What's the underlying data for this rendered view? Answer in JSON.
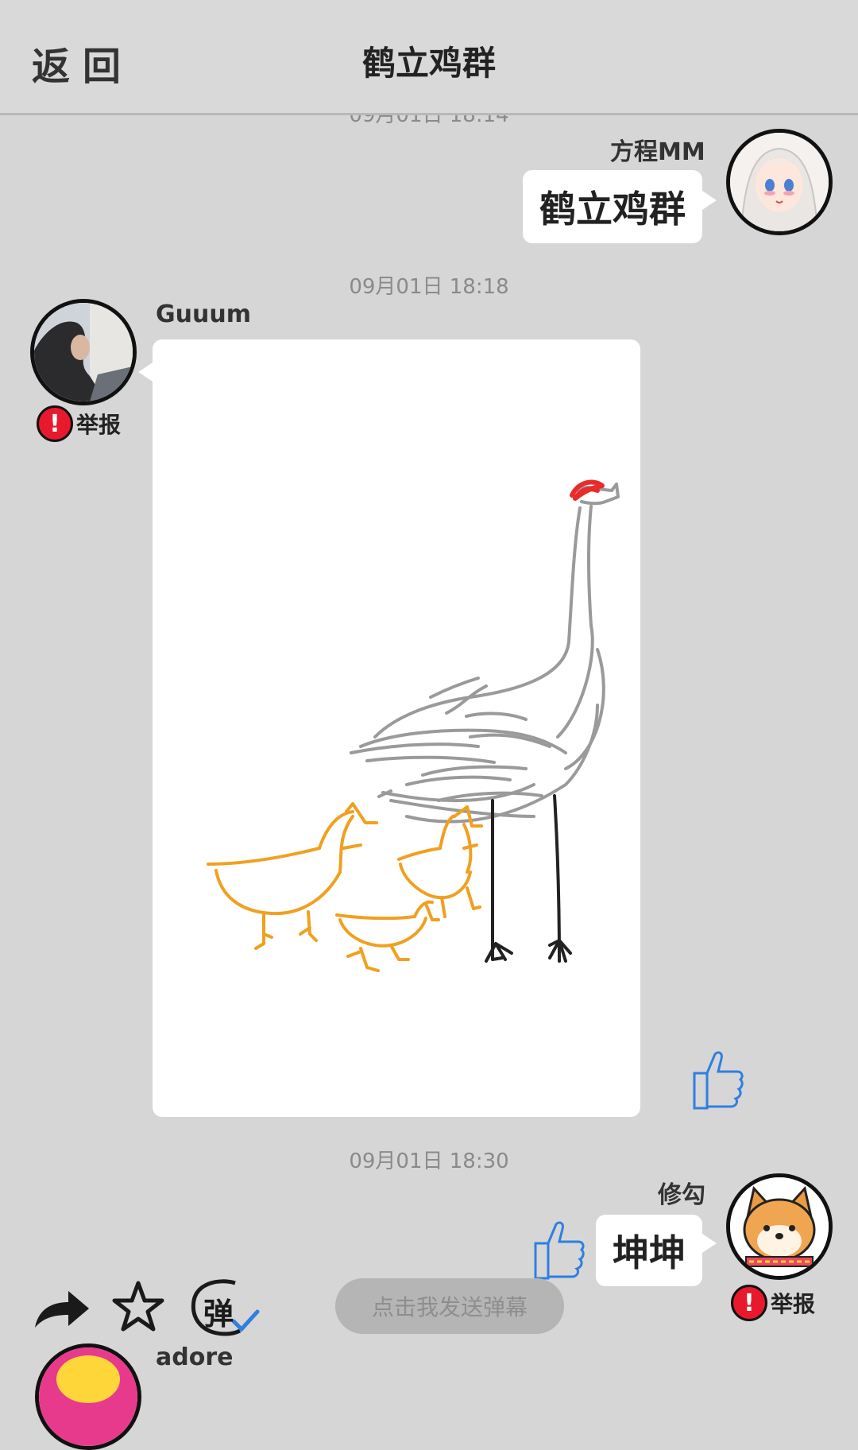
{
  "header": {
    "back_label": "返回",
    "title": "鹤立鸡群"
  },
  "messages": [
    {
      "timestamp_partial": "09月01日  18:14",
      "sender": "方程MM",
      "text": "鹤立鸡群",
      "side": "right"
    },
    {
      "timestamp": "09月01日  18:18",
      "sender": "Guuum",
      "type": "drawing",
      "side": "left",
      "report_label": "举报"
    },
    {
      "timestamp": "09月01日  18:30",
      "sender": "修勾",
      "text": "坤坤",
      "side": "right",
      "report_label": "举报"
    },
    {
      "sender": "adore",
      "side": "left",
      "partial": true
    }
  ],
  "toolbar": {
    "share_icon": "share-arrow-icon",
    "favorite_icon": "star-icon",
    "danmaku_icon": "danmaku-toggle-icon",
    "danmaku_icon_text": "弹",
    "danmaku_placeholder": "点击我发送弹幕"
  },
  "colors": {
    "background": "#d6d6d6",
    "bubble": "#ffffff",
    "report_red": "#e8192c",
    "thumb_blue": "#2f7fe0",
    "crane_gray": "#9a9a9a",
    "chicken_orange": "#f0a020",
    "crane_head_red": "#e82b2b"
  }
}
